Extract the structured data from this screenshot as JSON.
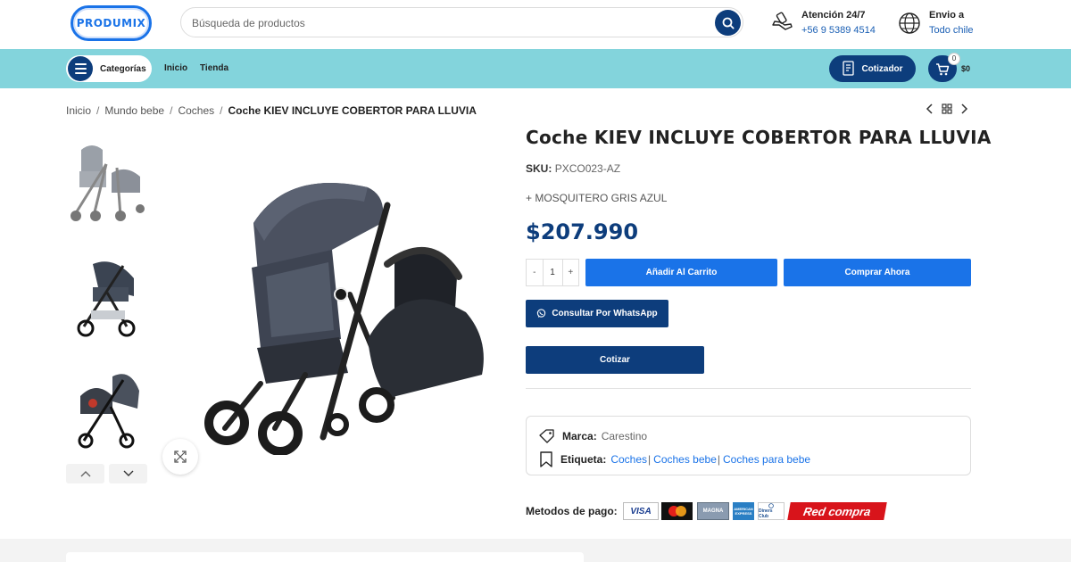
{
  "header": {
    "logo_text": "PRODUMIX",
    "search_placeholder": "Búsqueda de productos",
    "support_title": "Atención 24/7",
    "support_phone": "+56 9 5389 4514",
    "shipping_title": "Envio a",
    "shipping_region": "Todo chile"
  },
  "nav": {
    "categories_label": "Categorías",
    "links": [
      "Inicio",
      "Tienda"
    ],
    "cotizador_label": "Cotizador",
    "cart_count": "0",
    "cart_total": "$0"
  },
  "breadcrumb": {
    "items": [
      "Inicio",
      "Mundo bebe",
      "Coches"
    ],
    "current": "Coche KIEV INCLUYE COBERTOR PARA LLUVIA"
  },
  "product": {
    "title": "Coche KIEV INCLUYE COBERTOR PARA LLUVIA",
    "sku_label": "SKU:",
    "sku_value": "PXCO023-AZ",
    "extra": "+ MOSQUITERO GRIS AZUL",
    "price": "$207.990",
    "quantity": {
      "minus": "-",
      "value": "1",
      "plus": "+"
    },
    "add_to_cart_label": "Añadir Al Carrito",
    "buy_now_label": "Comprar Ahora",
    "whatsapp_label": "Consultar Por WhatsApp",
    "quote_label": "Cotizar",
    "gallery": {
      "thumbnails": [
        "stroller-double-grey",
        "stroller-side-view",
        "stroller-with-car-seat"
      ],
      "main_image": "stroller-with-infant-car-seat"
    }
  },
  "meta": {
    "brand_label": "Marca:",
    "brand_value": "Carestino",
    "tags_label": "Etiqueta:",
    "tags": [
      "Coches",
      "Coches bebe",
      "Coches para bebe"
    ]
  },
  "payment": {
    "label": "Metodos de pago:",
    "methods": [
      "VISA",
      "mastercard",
      "MAGNA",
      "AMERICAN EXPRESS",
      "Diners Club",
      "Red compra"
    ]
  },
  "colors": {
    "navy": "#0d3d7c",
    "blue": "#1a73e8",
    "nav_band": "#83d4dc"
  }
}
